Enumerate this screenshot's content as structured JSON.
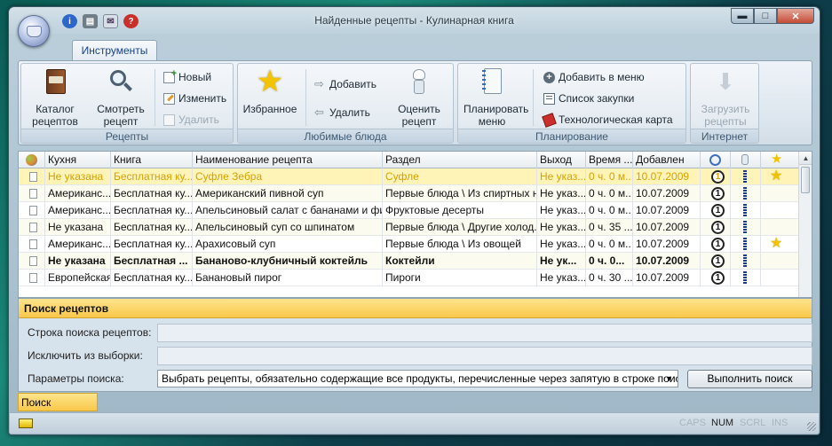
{
  "window": {
    "title": "Найденные рецепты - Кулинарная книга",
    "controls": {
      "minimize": "▬",
      "maximize": "□",
      "close": "✕"
    }
  },
  "quick_access": [
    "info-icon",
    "print-icon",
    "mail-icon",
    "help-icon"
  ],
  "ribbon": {
    "tab": "Инструменты",
    "groups": {
      "recipes": {
        "label": "Рецепты",
        "catalog": "Каталог рецептов",
        "view": "Смотреть рецепт",
        "new": "Новый",
        "edit": "Изменить",
        "delete": "Удалить"
      },
      "favorites": {
        "label": "Любимые блюда",
        "favorites": "Избранное",
        "add": "Добавить",
        "delete": "Удалить",
        "rate": "Оценить рецепт"
      },
      "planning": {
        "label": "Планирование",
        "plan_menu": "Планировать меню",
        "add_to_menu": "Добавить в меню",
        "shopping_list": "Список закупки",
        "tech_card": "Технологическая карта"
      },
      "internet": {
        "label": "Интернет",
        "download": "Загрузить рецепты"
      }
    }
  },
  "grid": {
    "columns": [
      "Кухня",
      "Книга",
      "Наименование рецепта",
      "Раздел",
      "Выход",
      "Время ...",
      "Добавлен"
    ],
    "rows": [
      {
        "cuisine": "Не указана",
        "book": "Бесплатная ку...",
        "name": "Суфле Зебра",
        "section": "Суфле",
        "yield": "Не указ...",
        "time": "0 ч. 0 м...",
        "added": "10.07.2009",
        "rating": "1",
        "star": true,
        "selected": true
      },
      {
        "cuisine": "Американс...",
        "book": "Бесплатная ку...",
        "name": "Американский пивной суп",
        "section": "Первые блюда \\ Из спиртных н...",
        "yield": "Не указ...",
        "time": "0 ч. 0 м...",
        "added": "10.07.2009",
        "rating": "1",
        "star": false
      },
      {
        "cuisine": "Американс...",
        "book": "Бесплатная ку...",
        "name": "Апельсиновый салат с бананами и фи...",
        "section": "Фруктовые десерты",
        "yield": "Не указ...",
        "time": "0 ч. 0 м...",
        "added": "10.07.2009",
        "rating": "1",
        "star": false
      },
      {
        "cuisine": "Не указана",
        "book": "Бесплатная ку...",
        "name": "Апельсиновый суп со шпинатом",
        "section": "Первые блюда \\ Другие холод...",
        "yield": "Не указ...",
        "time": "0 ч. 35 ...",
        "added": "10.07.2009",
        "rating": "1",
        "star": false
      },
      {
        "cuisine": "Американс...",
        "book": "Бесплатная ку...",
        "name": "Арахисовый суп",
        "section": "Первые блюда \\ Из овощей",
        "yield": "Не указ...",
        "time": "0 ч. 0 м...",
        "added": "10.07.2009",
        "rating": "1",
        "star": true
      },
      {
        "cuisine": "Не указана",
        "book": "Бесплатная ...",
        "name": "Бананово-клубничный коктейль",
        "section": "Коктейли",
        "yield": "Не ук...",
        "time": "0 ч. 0...",
        "added": "10.07.2009",
        "rating": "1",
        "star": false,
        "bold": true
      },
      {
        "cuisine": "Европейская",
        "book": "Бесплатная ку...",
        "name": "Банановый пирог",
        "section": "Пироги",
        "yield": "Не указ...",
        "time": "0 ч. 30 ...",
        "added": "10.07.2009",
        "rating": "1",
        "star": false
      }
    ]
  },
  "search": {
    "title": "Поиск рецептов",
    "query_label": "Строка поиска рецептов:",
    "exclude_label": "Исключить из выборки:",
    "params_label": "Параметры поиска:",
    "params_value": "Выбрать рецепты, обязательно содержащие все продукты, перечисленные через запятую в строке поиска.",
    "run_button": "Выполнить поиск",
    "tab": "Поиск рецептов"
  },
  "status": {
    "caps": "CAPS",
    "num": "NUM",
    "scrl": "SCRL",
    "ins": "INS"
  },
  "colors": {
    "selected_row": "#fff4b8",
    "search_header": "#f9c84a",
    "accent_text": "#15428b"
  }
}
